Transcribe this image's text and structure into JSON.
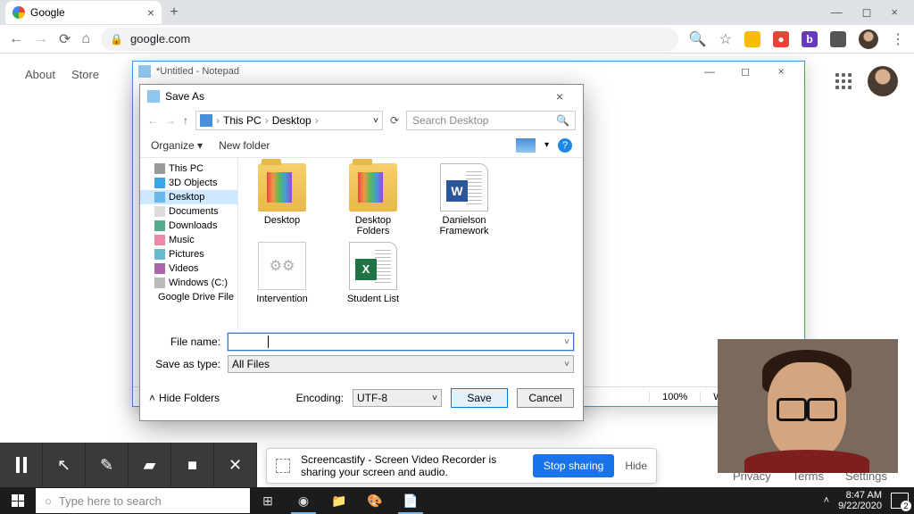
{
  "browser": {
    "tab_title": "Google",
    "url": "google.com",
    "nav": {
      "about": "About",
      "store": "Store"
    },
    "footer": {
      "privacy": "Privacy",
      "terms": "Terms",
      "settings": "Settings"
    }
  },
  "notepad": {
    "title": "*Untitled - Notepad",
    "status": {
      "zoom": "100%",
      "eol": "Windows (CRLF)"
    }
  },
  "saveas": {
    "title": "Save As",
    "breadcrumb": {
      "seg1": "This PC",
      "seg2": "Desktop"
    },
    "search_placeholder": "Search Desktop",
    "toolbar": {
      "organize": "Organize",
      "new_folder": "New folder"
    },
    "tree": [
      {
        "label": "This PC",
        "icon": "pc"
      },
      {
        "label": "3D Objects",
        "icon": "cube"
      },
      {
        "label": "Desktop",
        "icon": "desk",
        "selected": true
      },
      {
        "label": "Documents",
        "icon": "doc"
      },
      {
        "label": "Downloads",
        "icon": "dl"
      },
      {
        "label": "Music",
        "icon": "music"
      },
      {
        "label": "Pictures",
        "icon": "pic"
      },
      {
        "label": "Videos",
        "icon": "vid"
      },
      {
        "label": "Windows (C:)",
        "icon": "disk"
      },
      {
        "label": "Google Drive File",
        "icon": "gd"
      }
    ],
    "files": [
      {
        "name": "Desktop",
        "type": "folder-art"
      },
      {
        "name": "Desktop Folders",
        "type": "folder-art"
      },
      {
        "name": "Danielson Framework",
        "type": "word"
      },
      {
        "name": "Intervention",
        "type": "gear"
      },
      {
        "name": "Student List",
        "type": "excel"
      }
    ],
    "filename_label": "File name:",
    "filename_value": "",
    "savetype_label": "Save as type:",
    "savetype_value": "All Files",
    "hide_folders": "Hide Folders",
    "encoding_label": "Encoding:",
    "encoding_value": "UTF-8",
    "save_btn": "Save",
    "cancel_btn": "Cancel"
  },
  "screencast": {
    "message": "Screencastify - Screen Video Recorder is sharing your screen and audio.",
    "stop": "Stop sharing",
    "hide": "Hide"
  },
  "taskbar": {
    "search_placeholder": "Type here to search",
    "time": "8:47 AM",
    "date": "9/22/2020"
  }
}
